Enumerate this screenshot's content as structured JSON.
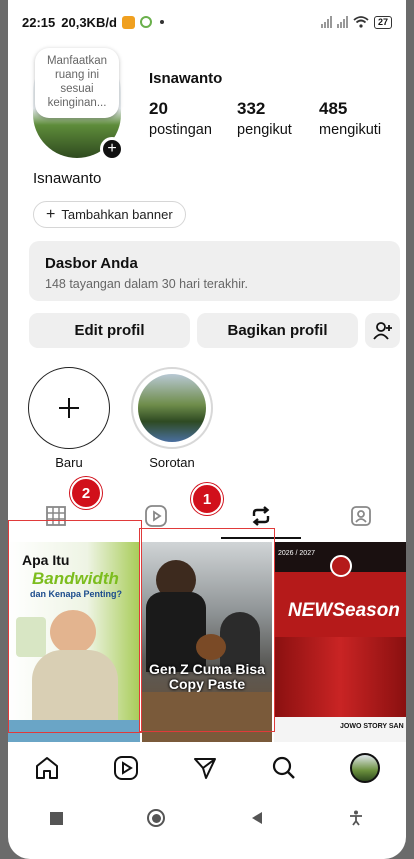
{
  "status_bar": {
    "time": "22:15",
    "speed": "20,3KB/d",
    "battery": "27"
  },
  "profile": {
    "note_text": "Manfaatkan ruang ini sesuai keinginan...",
    "username": "Isnawanto",
    "display_name": "Isnawanto",
    "stats": [
      {
        "value": "20",
        "label": "postingan"
      },
      {
        "value": "332",
        "label": "pengikut"
      },
      {
        "value": "485",
        "label": "mengikuti"
      }
    ],
    "add_banner_label": "Tambahkan banner"
  },
  "dashboard": {
    "title": "Dasbor Anda",
    "subtitle": "148 tayangan dalam 30 hari terakhir."
  },
  "actions": {
    "edit_profile": "Edit profil",
    "share_profile": "Bagikan profil"
  },
  "highlights": [
    {
      "label": "Baru"
    },
    {
      "label": "Sorotan"
    }
  ],
  "tabs": {
    "active": "reposts",
    "icons": [
      "grid-icon",
      "reels-icon",
      "repost-icon",
      "tagged-icon"
    ]
  },
  "annotations": {
    "badge_1": "1",
    "badge_2": "2"
  },
  "posts": [
    {
      "title_line1": "Apa Itu",
      "title_line2": "Bandwidth",
      "title_line3": "dan Kenapa Penting?"
    },
    {
      "caption": "Gen Z Cuma Bisa Copy Paste"
    },
    {
      "year": "2026 / 2027",
      "title": "NEWSeason",
      "footer": "JOWO STORY SAN"
    }
  ],
  "bottom_nav": [
    "home-icon",
    "reels-icon",
    "direct-message-icon",
    "search-icon",
    "profile-avatar"
  ],
  "colors": {
    "accent_red": "#d1101b",
    "annotation_box": "#e03a3a",
    "button_bg": "#efefef"
  }
}
